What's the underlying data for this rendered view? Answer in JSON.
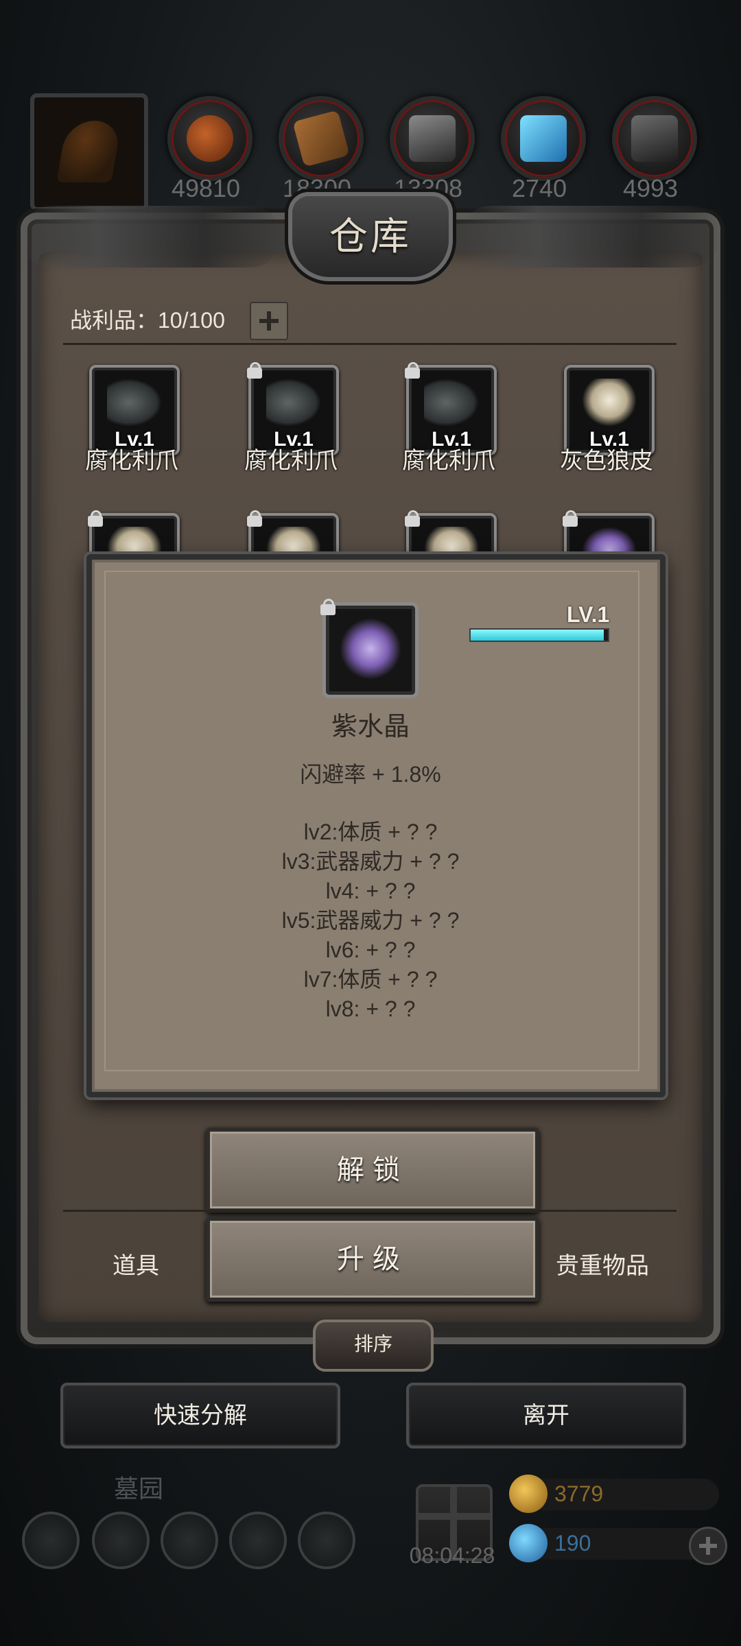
{
  "resources": {
    "counts": [
      "49810",
      "18300",
      "13308",
      "2740",
      "4993"
    ],
    "icons": [
      "orange-orb-icon",
      "wood-plank-icon",
      "iron-ingot-icon",
      "blue-crystal-icon",
      "dark-metal-icon"
    ]
  },
  "warehouse": {
    "title": "仓库",
    "loot_label": "战利品：10/100"
  },
  "items_row1": [
    {
      "level": "Lv.1",
      "name": "腐化利爪",
      "icon": "claw-icon"
    },
    {
      "level": "Lv.1",
      "name": "腐化利爪",
      "icon": "claw-icon"
    },
    {
      "level": "Lv.1",
      "name": "腐化利爪",
      "icon": "claw-icon"
    },
    {
      "level": "Lv.1",
      "name": "灰色狼皮",
      "icon": "pelt-icon"
    }
  ],
  "popup": {
    "level": "LV.1",
    "xp_fraction": 0.97,
    "item_name": "紫水晶",
    "stat": "闪避率 + 1.8%",
    "upgrades": [
      "lv2:体质 + ? ?",
      "lv3:武器威力 + ? ?",
      "lv4: + ? ?",
      "lv5:武器威力 + ? ?",
      "lv6: + ? ?",
      "lv7:体质 + ? ?",
      "lv8: + ? ?"
    ]
  },
  "buttons": {
    "unlock": "解锁",
    "upgrade": "升级",
    "sort": "排序",
    "quick_decompose": "快速分解",
    "leave": "离开"
  },
  "tabs": {
    "items": "道具",
    "valuables": "贵重物品"
  },
  "background": {
    "location": "墓园",
    "timer": "08:04:28",
    "gold": "3779",
    "gems": "190"
  }
}
